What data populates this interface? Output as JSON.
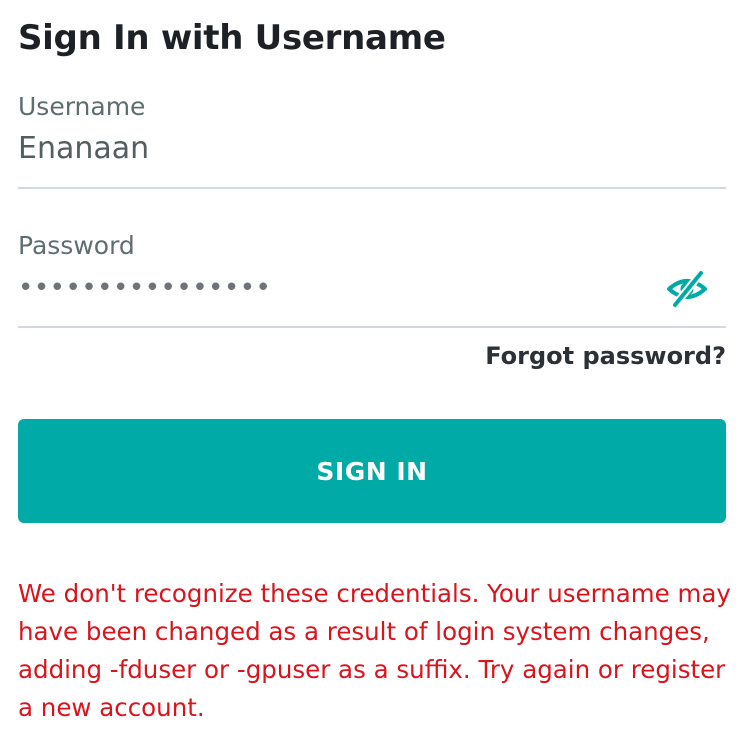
{
  "page": {
    "title": "Sign In with Username"
  },
  "username": {
    "label": "Username",
    "value": "Enanaan"
  },
  "password": {
    "label": "Password",
    "masked_value": "••••••••••••••••",
    "toggle_icon": "eye-slash-icon",
    "toggle_color": "#00aaa6"
  },
  "links": {
    "forgot_password": "Forgot password?"
  },
  "actions": {
    "sign_in_label": "SIGN IN",
    "sign_in_color": "#00aaa6"
  },
  "error": {
    "message": "We don't recognize these credentials. Your username may have been changed as a result of login system changes, adding -fduser or -gpuser as a suffix. Try again or register a new account.",
    "color": "#d9141c"
  }
}
